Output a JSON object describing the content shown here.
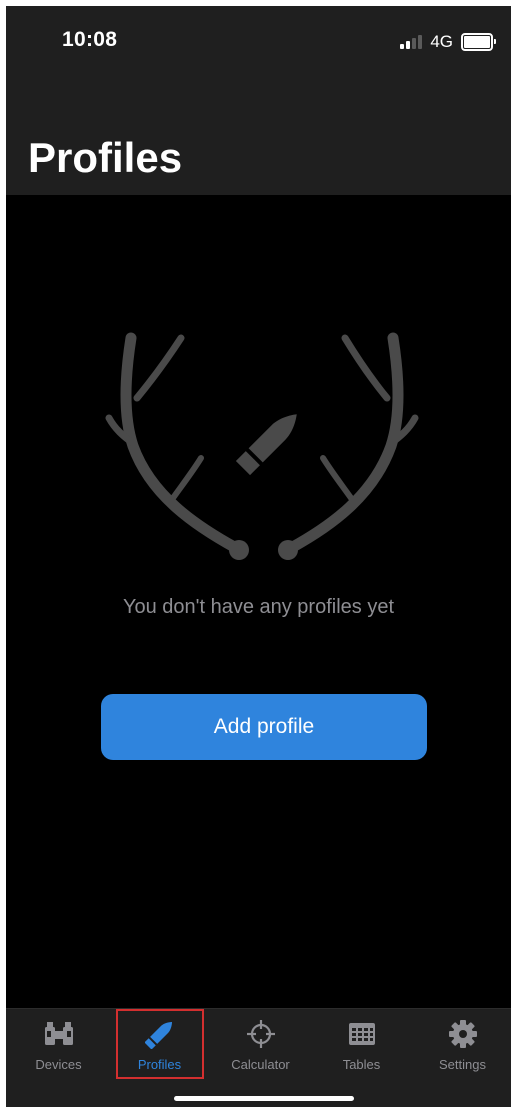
{
  "status_bar": {
    "time": "10:08",
    "network": "4G"
  },
  "header": {
    "title": "Profiles"
  },
  "empty_state": {
    "message": "You don't have any profiles yet",
    "button_label": "Add profile"
  },
  "tabbar": {
    "tabs": [
      {
        "label": "Devices",
        "icon": "binoculars-icon",
        "active": false
      },
      {
        "label": "Profiles",
        "icon": "bullet-icon",
        "active": true
      },
      {
        "label": "Calculator",
        "icon": "crosshair-icon",
        "active": false
      },
      {
        "label": "Tables",
        "icon": "table-icon",
        "active": false
      },
      {
        "label": "Settings",
        "icon": "gear-icon",
        "active": false
      }
    ]
  },
  "colors": {
    "accent": "#2f84dd",
    "background": "#000000",
    "bar": "#1f1f1f",
    "muted": "#8e8e93",
    "highlight": "#d32f2f"
  }
}
